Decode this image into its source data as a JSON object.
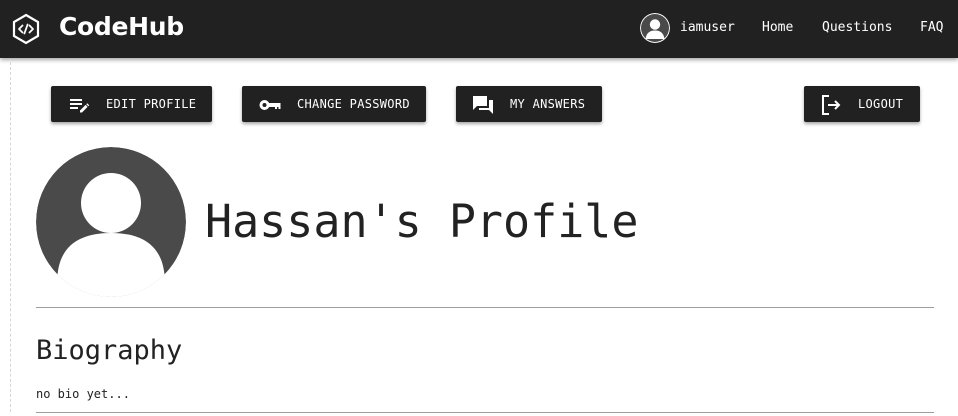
{
  "navbar": {
    "brand": "CodeHub",
    "username": "iamuser",
    "links": [
      "Home",
      "Questions",
      "FAQ"
    ]
  },
  "actions": {
    "edit_profile": "EDIT PROFILE",
    "change_password": "CHANGE PASSWORD",
    "my_answers": "MY ANSWERS",
    "logout": "LOGOUT"
  },
  "profile": {
    "title": "Hassan's Profile"
  },
  "biography": {
    "heading": "Biography",
    "text": "no bio yet..."
  },
  "icons": {
    "brand": "code-hexagon-icon",
    "user_avatar": "user-avatar-icon",
    "edit_profile": "edit-notes-icon",
    "change_password": "key-icon",
    "my_answers": "forum-icon",
    "logout": "logout-icon"
  },
  "colors": {
    "navbar_bg": "#212121",
    "button_bg": "#212121",
    "text_on_dark": "#ffffff",
    "avatar_gray": "#4a4a4a",
    "rule_gray": "#9e9e9e"
  }
}
